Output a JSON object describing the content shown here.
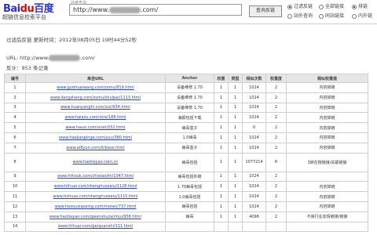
{
  "header": {
    "logo_main": "Bai",
    "logo_paw": "du",
    "logo_cn": "百度",
    "logo_sub": "超链信息检索平台",
    "input_hint": "外链查询",
    "search_prefix": "http://www.",
    "search_suffix": ".com/",
    "query_button": "查询反链",
    "options": [
      "过滤反链",
      "站外查询",
      "全部链接",
      "同站链接",
      "排链",
      "内外链"
    ]
  },
  "info": {
    "line1": "过滤后反链   更新时间：2012年08月05日 19时44分52秒",
    "url_prefix": "URL: http://www.",
    "url_suffix": ".com/",
    "total": "反计：953 条记录"
  },
  "table": {
    "headers": [
      "编号",
      "来自URL",
      "Anchor",
      "权重",
      "类型",
      "相似次数",
      "权重度",
      "相似权重值"
    ],
    "rows": [
      [
        "1",
        "www.guohuaiwang.com/zsmu/819.html",
        "设备维修 1.70",
        "1",
        "1",
        "1024",
        "2",
        "内容掉链"
      ],
      [
        "2",
        "www.liangsheng.com/zsmu/shuipai/1113.html",
        "设备维修 1.70",
        "1",
        "1",
        "1024",
        "2",
        "内容掉链"
      ],
      [
        "3",
        "www.huanyanghi.com/xui/934.html",
        "设备维修 1.70",
        "1",
        "1",
        "1024",
        "2",
        "内容掉链"
      ],
      [
        "4",
        "www.haiasu.com/vtre/188.html",
        "海报包括下载",
        "1",
        "1",
        "1024",
        "2",
        "内容掉链"
      ],
      [
        "5",
        "www.hausi.com/vnet/252.html",
        "病毒盒子",
        "1",
        "1",
        "0",
        "2",
        "内容掉链"
      ],
      [
        "6",
        "www.haojianpinge.com/yxu/380.html",
        "1.0病毒",
        "1",
        "1",
        "1024",
        "2",
        "内容掉链"
      ],
      [
        "7",
        "www.ai8yun.com/it/base.html",
        "病毒盒子",
        "1",
        "1",
        "1024",
        "2",
        "内容掉链"
      ],
      [
        "8",
        "www.haotieyao.com.cn",
        "病毒包括",
        "1",
        "1",
        "1077214",
        "6",
        "3转在按链接/关联链接"
      ],
      [
        "9",
        "www.hthouk.com/zhixiaozhi/1047.html",
        "病毒包括外链",
        "1",
        "1",
        "1024",
        "2",
        ""
      ],
      [
        "10",
        "www.hthuar.com/shenghuozaiu/1128.html",
        "1.70病毒包括",
        "1",
        "1",
        "1024",
        "2",
        "内容掉链"
      ],
      [
        "11",
        "www.tixhuas.com/shenghuozaiu/1115.html",
        "1.0病毒包括",
        "1",
        "1",
        "1024",
        "2",
        "内容掉链"
      ],
      [
        "12",
        "www.hezouxiaoxing.com/moren/737.html",
        "病毒包括",
        "1",
        "1",
        "1024",
        "2",
        "内容掉链"
      ],
      [
        "13",
        "www.haotieyao.com/qwenshuzai/mju/958.html",
        "病毒",
        "1",
        "1",
        "4096",
        "2",
        "不良行业友情链接/链接"
      ],
      [
        "14",
        "www.hthuar.com/ge/quanzhi/111.html",
        "",
        "",
        "",
        "",
        "",
        ""
      ]
    ]
  }
}
